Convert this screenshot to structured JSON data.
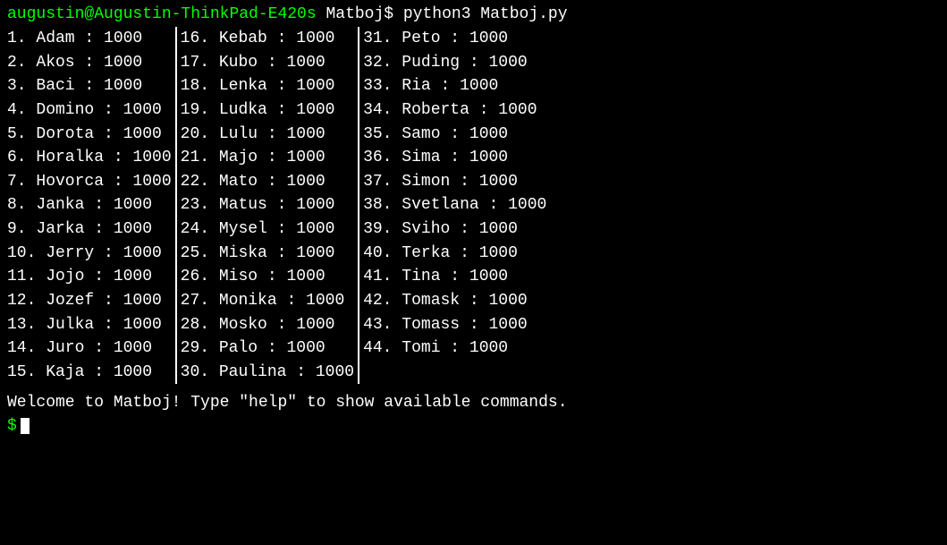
{
  "terminal": {
    "title_user": "augustin@Augustin-ThinkPad-E420s",
    "title_separator": " ",
    "title_command": "Matboj$ python3 Matboj.py",
    "col1": [
      {
        "num": "1.",
        "name": "Adam",
        "score": ": 1000"
      },
      {
        "num": "2.",
        "name": "Akos",
        "score": ": 1000"
      },
      {
        "num": "3.",
        "name": "Baci",
        "score": ": 1000"
      },
      {
        "num": "4.",
        "name": "Domino",
        "score": ": 1000"
      },
      {
        "num": "5.",
        "name": "Dorota",
        "score": ": 1000"
      },
      {
        "num": "6.",
        "name": "Horalka",
        "score": ": 1000"
      },
      {
        "num": "7.",
        "name": "Hovorca",
        "score": ": 1000"
      },
      {
        "num": "8.",
        "name": "Janka",
        "score": ": 1000"
      },
      {
        "num": "9.",
        "name": "Jarka",
        "score": ": 1000"
      },
      {
        "num": "10.",
        "name": "Jerry",
        "score": ": 1000"
      },
      {
        "num": "11.",
        "name": "Jojo",
        "score": ": 1000"
      },
      {
        "num": "12.",
        "name": "Jozef",
        "score": ": 1000"
      },
      {
        "num": "13.",
        "name": "Julka",
        "score": ": 1000"
      },
      {
        "num": "14.",
        "name": "Juro",
        "score": ": 1000"
      },
      {
        "num": "15.",
        "name": "Kaja",
        "score": ": 1000"
      }
    ],
    "col2": [
      {
        "num": "16.",
        "name": "Kebab",
        "score": ": 1000"
      },
      {
        "num": "17.",
        "name": "Kubo",
        "score": ": 1000"
      },
      {
        "num": "18.",
        "name": "Lenka",
        "score": ": 1000"
      },
      {
        "num": "19.",
        "name": "Ludka",
        "score": ": 1000"
      },
      {
        "num": "20.",
        "name": "Lulu",
        "score": ": 1000"
      },
      {
        "num": "21.",
        "name": "Majo",
        "score": ": 1000"
      },
      {
        "num": "22.",
        "name": "Mato",
        "score": ": 1000"
      },
      {
        "num": "23.",
        "name": "Matus",
        "score": ": 1000"
      },
      {
        "num": "24.",
        "name": "Mysel",
        "score": ": 1000"
      },
      {
        "num": "25.",
        "name": "Miska",
        "score": ": 1000"
      },
      {
        "num": "26.",
        "name": "Miso",
        "score": ": 1000"
      },
      {
        "num": "27.",
        "name": "Monika",
        "score": ": 1000"
      },
      {
        "num": "28.",
        "name": "Mosko",
        "score": ": 1000"
      },
      {
        "num": "29.",
        "name": "Palo",
        "score": ": 1000"
      },
      {
        "num": "30.",
        "name": "Paulina",
        "score": ": 1000"
      }
    ],
    "col3": [
      {
        "num": "31.",
        "name": "Peto",
        "score": ": 1000"
      },
      {
        "num": "32.",
        "name": "Puding",
        "score": ": 1000"
      },
      {
        "num": "33.",
        "name": "Ria",
        "score": ": 1000"
      },
      {
        "num": "34.",
        "name": "Roberta",
        "score": ": 1000"
      },
      {
        "num": "35.",
        "name": "Samo",
        "score": ": 1000"
      },
      {
        "num": "36.",
        "name": "Sima",
        "score": ": 1000"
      },
      {
        "num": "37.",
        "name": "Simon",
        "score": ": 1000"
      },
      {
        "num": "38.",
        "name": "Svetlana",
        "score": ": 1000"
      },
      {
        "num": "39.",
        "name": "Sviho",
        "score": ": 1000"
      },
      {
        "num": "40.",
        "name": "Terka",
        "score": ": 1000"
      },
      {
        "num": "41.",
        "name": "Tina",
        "score": ": 1000"
      },
      {
        "num": "42.",
        "name": "Tomask",
        "score": ": 1000"
      },
      {
        "num": "43.",
        "name": "Tomass",
        "score": ": 1000"
      },
      {
        "num": "44.",
        "name": "Tomi",
        "score": ": 1000"
      }
    ],
    "welcome_message": "Welcome to Matboj! Type \"help\" to show available commands.",
    "prompt": "$"
  }
}
